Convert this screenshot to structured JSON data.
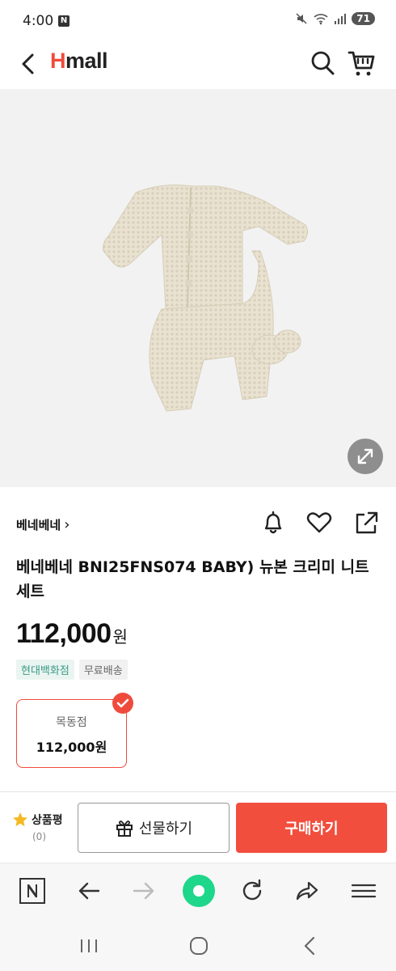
{
  "status_bar": {
    "time": "4:00",
    "notification_badge": "N",
    "battery": "71"
  },
  "header": {
    "logo_first": "H",
    "logo_rest": "mall"
  },
  "product": {
    "brand": "베네베네",
    "brand_chevron": "›",
    "title": "베네베네 BNI25FNS074 BABY) 뉴본 크리미 니트 세트",
    "price": "112,000",
    "price_unit": "원",
    "badges": [
      "현대백화점",
      "무료배송"
    ]
  },
  "store": {
    "name": "목동점",
    "price": "112,000원"
  },
  "bottom_bar": {
    "review_label": "상품평",
    "review_count": "(0)",
    "gift_label": "선물하기",
    "buy_label": "구매하기"
  },
  "colors": {
    "accent": "#ef4b3c",
    "dept_badge_text": "#3a9a84",
    "browser_home": "#1ed78a"
  },
  "icons": [
    "back-arrow-icon",
    "search-icon",
    "cart-icon",
    "expand-icon",
    "bell-icon",
    "heart-icon",
    "share-icon",
    "star-icon",
    "gift-icon",
    "naver-icon",
    "browser-back-icon",
    "browser-forward-icon",
    "home-dot-icon",
    "refresh-icon",
    "browser-share-icon",
    "menu-icon"
  ]
}
